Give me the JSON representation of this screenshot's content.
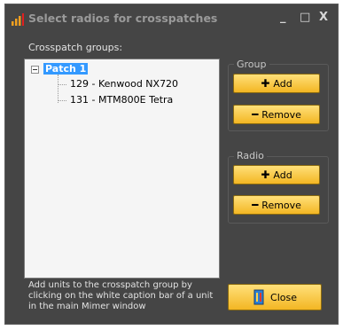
{
  "window": {
    "title": "Select radios for crosspatches",
    "minimize": "_",
    "maximize": "□",
    "close": "X"
  },
  "crosspatch_label": "Crosspatch groups:",
  "tree": {
    "root": "Patch 1",
    "children": [
      "129 - Kenwood NX720",
      "131 - MTM800E Tetra"
    ]
  },
  "group": {
    "title": "Group",
    "add": "Add",
    "remove": "Remove"
  },
  "radio": {
    "title": "Radio",
    "add": "Add",
    "remove": "Remove"
  },
  "help_text": "Add units to the crosspatch group by clicking on the white caption bar of a unit in the main Mimer window",
  "close_label": "Close"
}
